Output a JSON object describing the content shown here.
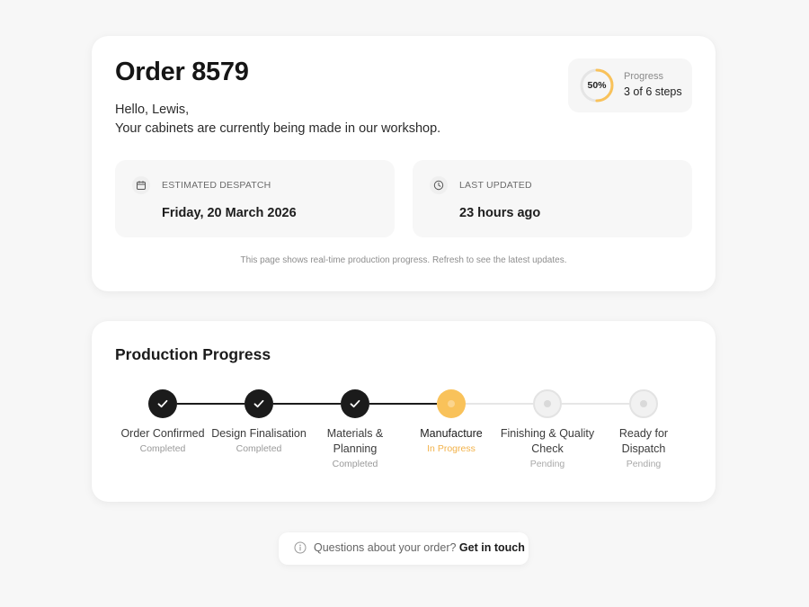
{
  "order": {
    "title": "Order 8579",
    "greeting": "Hello, Lewis,",
    "message": "Your cabinets are currently being made in our workshop."
  },
  "progress_summary": {
    "percent": 50,
    "percent_label": "50%",
    "label": "Progress",
    "steps_text": "3 of 6 steps",
    "ring_color": "#f9c25a",
    "ring_track_color": "#e5e5e5"
  },
  "despatch": {
    "icon": "calendar-icon",
    "label": "ESTIMATED DESPATCH",
    "value": "Friday, 20 March 2026"
  },
  "updated": {
    "icon": "clock-icon",
    "label": "LAST UPDATED",
    "value": "23 hours ago"
  },
  "refresh_note": "This page shows real-time production progress. Refresh to see the latest updates.",
  "production": {
    "title": "Production Progress",
    "steps": [
      {
        "name": "Order Confirmed",
        "status": "Completed",
        "state": "completed"
      },
      {
        "name": "Design Finalisation",
        "status": "Completed",
        "state": "completed"
      },
      {
        "name": "Materials & Planning",
        "status": "Completed",
        "state": "completed"
      },
      {
        "name": "Manufacture",
        "status": "In Progress",
        "state": "in-progress"
      },
      {
        "name": "Finishing & Quality Check",
        "status": "Pending",
        "state": "pending"
      },
      {
        "name": "Ready for Dispatch",
        "status": "Pending",
        "state": "pending"
      }
    ]
  },
  "help": {
    "icon": "info-icon",
    "question": "Questions about your order?",
    "link_label": "Get in touch"
  },
  "colors": {
    "accent": "#f9c25a",
    "completed": "#1b1b1b",
    "pending": "#e6e6e6"
  }
}
